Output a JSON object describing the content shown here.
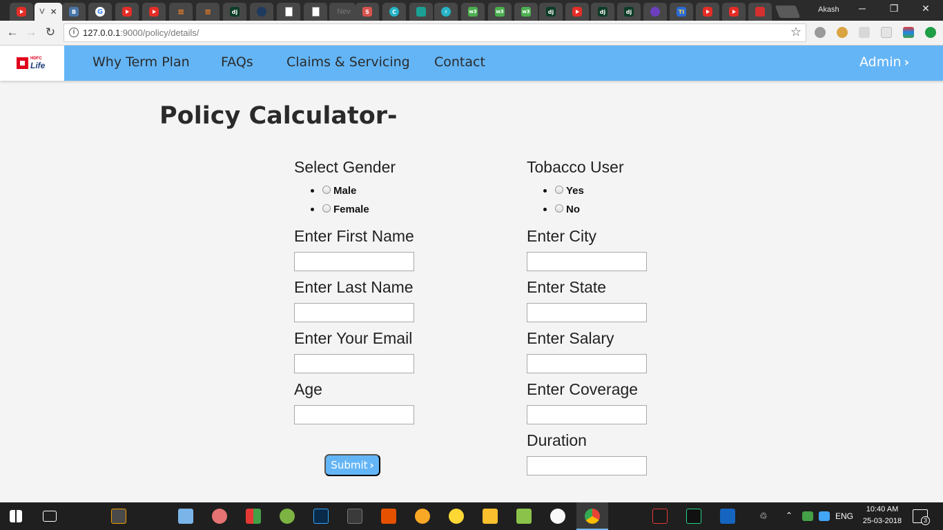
{
  "browser": {
    "profile_name": "Akash",
    "active_tab_label": "V",
    "new_tab_label": "Nev",
    "url_host": "127.0.0.1",
    "url_path": ":9000/policy/details/"
  },
  "site": {
    "logo_top": "HDFC",
    "logo_main": "Life",
    "nav": [
      "Why Term Plan",
      "FAQs",
      "Claims & Servicing",
      "Contact"
    ],
    "admin_label": "Admin"
  },
  "form": {
    "title": "Policy Calculator-",
    "gender_label": "Select Gender",
    "gender_options": [
      "Male",
      "Female"
    ],
    "tobacco_label": "Tobacco User",
    "tobacco_options": [
      "Yes",
      "No"
    ],
    "left_fields": [
      "Enter First Name",
      "Enter Last Name",
      "Enter Your Email",
      "Age"
    ],
    "right_fields": [
      "Enter City",
      "Enter State",
      "Enter Salary",
      "Enter Coverage",
      "Duration"
    ],
    "submit_label": "Submit"
  },
  "taskbar": {
    "language": "ENG",
    "time": "10:40 AM",
    "date": "25-03-2018",
    "notification_count": "3"
  }
}
